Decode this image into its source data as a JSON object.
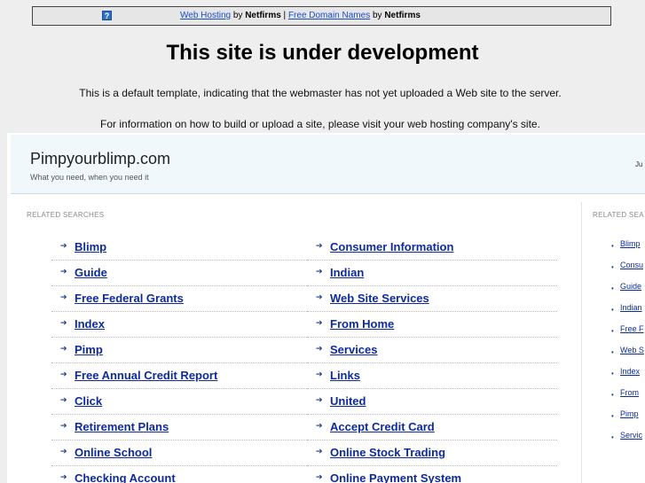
{
  "topbar": {
    "help_icon": "question-icon",
    "link1": "Web Hosting",
    "by1": " by ",
    "brand1": "Netfirms",
    "sep": " | ",
    "link2": "Free Domain Names",
    "by2": " by ",
    "brand2": "Netfirms"
  },
  "notice": {
    "heading": "This site is under development",
    "line1": "This is a default template, indicating that the webmaster has not yet uploaded a Web site to the server.",
    "line2": "For information on how to build or upload a site, please visit your web hosting company's site."
  },
  "site": {
    "title": "Pimpyourblimp.com",
    "tagline": "What you need, when you need it",
    "date_fragment": "Ju"
  },
  "related": {
    "label_left": "RELATED SEARCHES",
    "label_right": "RELATED SEA",
    "col1": [
      "Blimp",
      "Guide",
      "Free Federal Grants",
      "Index",
      "Pimp",
      "Free Annual Credit Report",
      "Click",
      "Retirement Plans",
      "Online School",
      "Checking Account"
    ],
    "col2": [
      "Consumer Information",
      "Indian",
      "Web Site Services",
      "From Home",
      "Services",
      "Links",
      "United",
      "Accept Credit Card",
      "Online Stock Trading",
      "Online Payment System"
    ],
    "side": [
      "Blimp",
      "Consu",
      "Guide",
      "Indian",
      "Free F",
      "Web S",
      "Index",
      "From",
      "Pimp",
      "Servic"
    ]
  }
}
